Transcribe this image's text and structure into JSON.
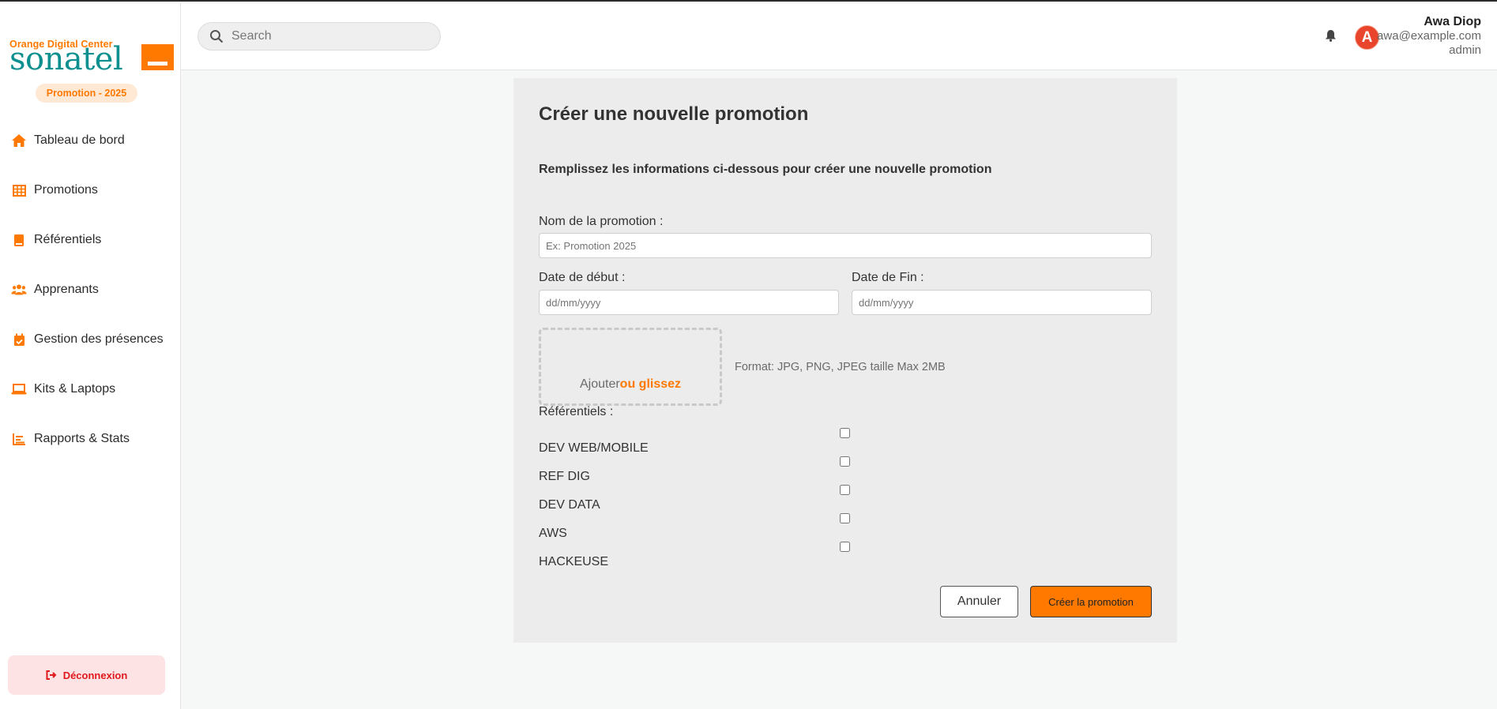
{
  "colors": {
    "accent": "#ff7900",
    "brand_teal": "#0b8f8f",
    "logout_bg": "#fde3e4",
    "logout_text": "#e0191d",
    "avatar_bg": "#e8452c"
  },
  "sidebar": {
    "logo_top": "Orange Digital Center",
    "logo_main": "sonatel",
    "promo_badge": "Promotion - 2025",
    "items": [
      {
        "label": "Tableau de bord",
        "icon": "home-icon"
      },
      {
        "label": "Promotions",
        "icon": "grid-icon"
      },
      {
        "label": "Référentiels",
        "icon": "book-icon"
      },
      {
        "label": "Apprenants",
        "icon": "users-icon"
      },
      {
        "label": "Gestion des présences",
        "icon": "calendar-check-icon"
      },
      {
        "label": "Kits & Laptops",
        "icon": "laptop-icon"
      },
      {
        "label": "Rapports & Stats",
        "icon": "bar-chart-icon"
      }
    ],
    "logout_label": "Déconnexion"
  },
  "header": {
    "search_placeholder": "Search",
    "user": {
      "initial": "A",
      "name": "Awa Diop",
      "email": "awa@example.com",
      "role": "admin"
    }
  },
  "form": {
    "title": "Créer une nouvelle promotion",
    "subtitle": "Remplissez les informations ci-dessous pour créer une nouvelle promotion",
    "name_label": "Nom de la promotion :",
    "name_placeholder": "Ex: Promotion 2025",
    "start_label": "Date de début :",
    "start_placeholder": "dd/mm/yyyy",
    "end_label": "Date de Fin :",
    "end_placeholder": "dd/mm/yyyy",
    "upload_text": "Ajouter",
    "upload_accent": "ou glissez",
    "upload_format": "Format: JPG, PNG, JPEG taille Max 2MB",
    "referentiels_label": "Référentiels :",
    "referentiels": [
      {
        "name": "DEV WEB/MOBILE",
        "checked": false
      },
      {
        "name": "REF DIG",
        "checked": false
      },
      {
        "name": "DEV DATA",
        "checked": false
      },
      {
        "name": "AWS",
        "checked": false
      },
      {
        "name": "HACKEUSE",
        "checked": false
      }
    ],
    "cancel_label": "Annuler",
    "submit_label": "Créer la promotion"
  }
}
